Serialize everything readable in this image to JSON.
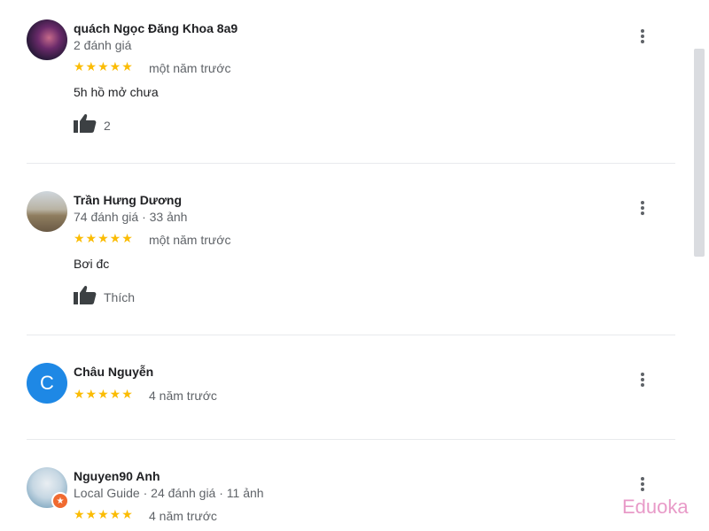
{
  "reviews": [
    {
      "name": "quách Ngọc Đăng Khoa 8a9",
      "meta": "2 đánh giá",
      "stars": "★★★★★",
      "time": "một năm trước",
      "text": "5h hồ mở chưa",
      "like": "2",
      "avatar": "profile-photo"
    },
    {
      "name": "Trần Hưng Dương",
      "meta": "74 đánh giá · 33 ảnh",
      "stars": "★★★★★",
      "time": "một năm trước",
      "text": "Bơi đc",
      "like": "Thích",
      "avatar": "profile-photo"
    },
    {
      "name": "Châu Nguyễn",
      "stars": "★★★★★",
      "time": "4 năm trước",
      "avatar_letter": "C",
      "avatar_color": "#1e88e5"
    },
    {
      "name": "Nguyen90 Anh",
      "meta": "Local Guide · 24 đánh giá · 11 ảnh",
      "stars": "★★★★★",
      "time": "4 năm trước",
      "avatar": "profile-photo",
      "badge": "local-guide-badge"
    }
  ],
  "rating": 5,
  "colors": {
    "star": "#fbbc04",
    "secondary_text": "#5f6368"
  },
  "watermark": "Eduoka"
}
